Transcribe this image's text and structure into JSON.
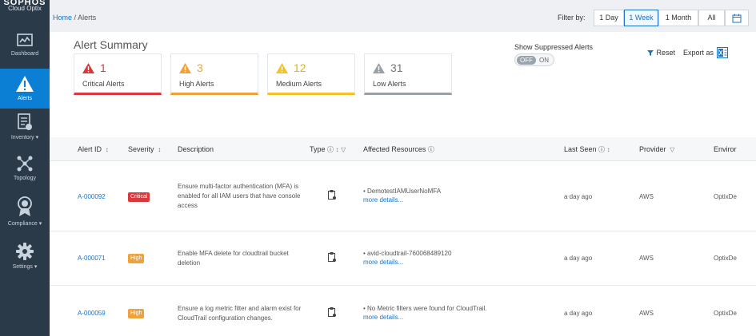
{
  "brand": {
    "top": "SOPHOS",
    "sub": "Cloud Optix"
  },
  "sidebar": {
    "items": [
      {
        "label": "Dashboard",
        "icon": "chart-icon"
      },
      {
        "label": "Alerts",
        "icon": "warning-icon"
      },
      {
        "label": "Inventory ▾",
        "icon": "inventory-icon"
      },
      {
        "label": "Topology",
        "icon": "topology-icon"
      },
      {
        "label": "Compliance ▾",
        "icon": "award-icon"
      },
      {
        "label": "Settings ▾",
        "icon": "gear-icon"
      }
    ]
  },
  "breadcrumb": {
    "home": "Home",
    "sep": "/",
    "current": "Alerts"
  },
  "filter": {
    "label": "Filter by:",
    "options": [
      "1 Day",
      "1 Week",
      "1 Month",
      "All"
    ],
    "selected": "1 Week"
  },
  "summary": {
    "title": "Alert Summary",
    "cards": [
      {
        "count": "1",
        "label": "Critical Alerts",
        "color": "#d9383c"
      },
      {
        "count": "3",
        "label": "High Alerts",
        "color": "#f0a23a"
      },
      {
        "count": "12",
        "label": "Medium Alerts",
        "color": "#f2c22a"
      },
      {
        "count": "31",
        "label": "Low Alerts",
        "color": "#9aa0a6"
      }
    ],
    "suppressed_label": "Show Suppressed Alerts",
    "toggle_off": "OFF",
    "toggle_on": "ON",
    "reset": "Reset",
    "export": "Export as"
  },
  "table": {
    "headers": {
      "id": "Alert ID",
      "severity": "Severity",
      "description": "Description",
      "type": "Type",
      "resources": "Affected Resources",
      "last_seen": "Last Seen",
      "provider": "Provider",
      "environment": "Enviror"
    },
    "rows": [
      {
        "id": "A-000092",
        "severity": "Critical",
        "description": "Ensure multi-factor authentication (MFA) is enabled for all IAM users that have console access",
        "resource": "DemotestIAMUserNoMFA",
        "more": "more details...",
        "last_seen": "a day ago",
        "provider": "AWS",
        "environment": "OptixDe"
      },
      {
        "id": "A-000071",
        "severity": "High",
        "description": "Enable MFA delete for cloudtrail bucket deletion",
        "resource": "avid-cloudtrail-760068489120",
        "more": "more details...",
        "last_seen": "a day ago",
        "provider": "AWS",
        "environment": "OptixDe"
      },
      {
        "id": "A-000059",
        "severity": "High",
        "description": "Ensure a log metric filter and alarm exist for CloudTrail configuration changes.",
        "resource": "No Metric filters were found for CloudTrail.",
        "more": "more details...",
        "last_seen": "a day ago",
        "provider": "AWS",
        "environment": "OptixDe"
      }
    ]
  }
}
